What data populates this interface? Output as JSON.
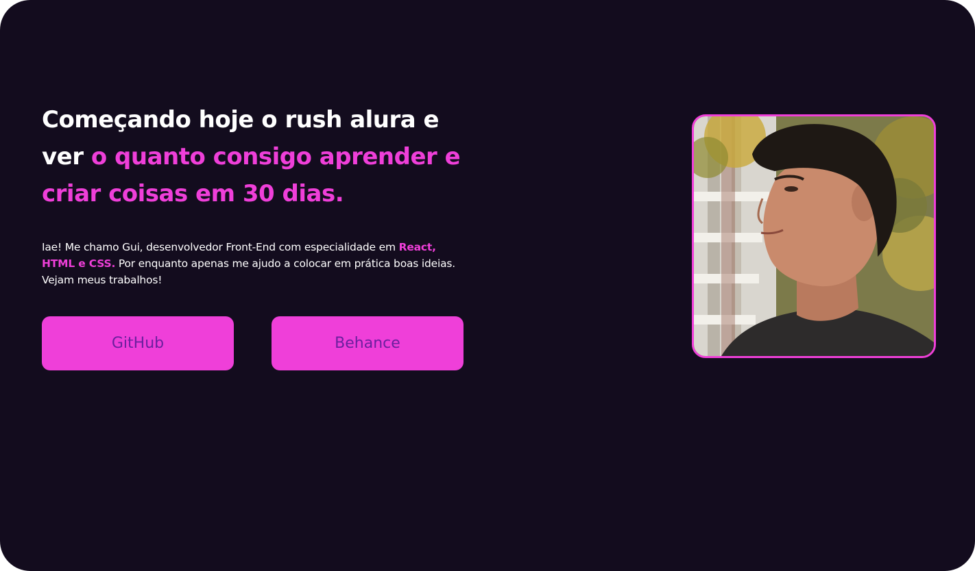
{
  "hero": {
    "headline_part1": "Começando hoje o rush alura e ver ",
    "headline_part2": "o quanto consigo aprender e criar coisas em 30 dias.",
    "intro_part1": "Iae! Me chamo Gui, desenvolvedor Front-End com especialidade em ",
    "intro_part2": "React, HTML e CSS.",
    "intro_part3": " Por enquanto apenas me ajudo a colocar em prática boas ideias. Vejam meus trabalhos!"
  },
  "buttons": {
    "github_label": "GitHub",
    "behance_label": "Behance"
  },
  "colors": {
    "background": "#130c1e",
    "accent": "#ef3fd9",
    "button_text": "#6b1f9e",
    "text": "#ffffff"
  }
}
